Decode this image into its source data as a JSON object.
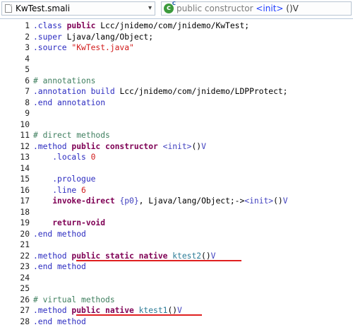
{
  "toolbar": {
    "file_name": "KwTest.smali",
    "method_prefix": "public constructor ",
    "method_name": "<init>",
    "method_suffix": " ()V"
  },
  "code": {
    "l1": [
      ".class",
      " public",
      " Lcc/jnidemo/com/jnidemo/KwTest;"
    ],
    "l2": [
      ".super",
      " Ljava/lang/Object;"
    ],
    "l3": [
      ".source",
      " \"KwTest.java\""
    ],
    "l6": "# annotations",
    "l7": [
      ".annotation",
      " build",
      " Lcc/jnidemo/com/jnidemo/LDPProtect;"
    ],
    "l8": [
      ".end annotation"
    ],
    "l11": "# direct methods",
    "l12": [
      ".method",
      " public constructor",
      " <init>",
      "()",
      "V"
    ],
    "l13": [
      ".locals",
      " 0"
    ],
    "l15": ".prologue",
    "l16": [
      ".line",
      " 6"
    ],
    "l17": [
      "invoke-direct",
      " {p0}",
      ", Ljava/lang/Object;->",
      "<init>",
      "()",
      "V"
    ],
    "l19": "return-void",
    "l20": ".end method",
    "l22": [
      ".method",
      " public static native",
      " ktest2",
      "()",
      "V"
    ],
    "l23": ".end method",
    "l26": "# virtual methods",
    "l27": [
      ".method",
      " public native",
      " ktest1",
      "()",
      "V"
    ],
    "l28": ".end method"
  },
  "line_numbers": [
    "1",
    "2",
    "3",
    "4",
    "5",
    "6",
    "7",
    "8",
    "9",
    "10",
    "11",
    "12",
    "13",
    "14",
    "15",
    "16",
    "17",
    "18",
    "19",
    "20",
    "21",
    "22",
    "23",
    "24",
    "25",
    "26",
    "27",
    "28"
  ]
}
